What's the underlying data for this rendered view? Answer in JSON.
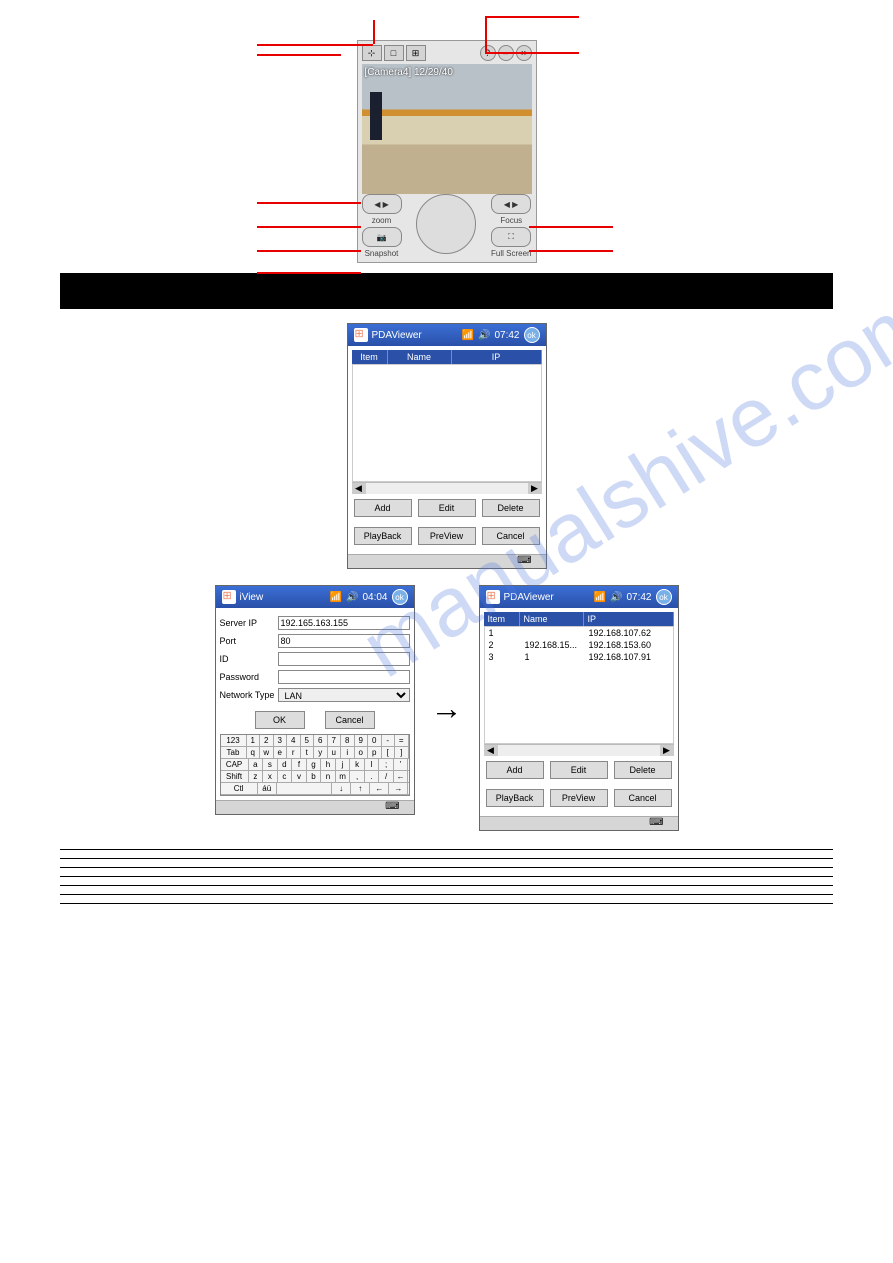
{
  "camera": {
    "overlay_text": "[Camera4] 12/29/40",
    "controls": {
      "zoom": "zoom",
      "snapshot": "Snapshot",
      "focus": "Focus",
      "fullscreen": "Full Screen"
    }
  },
  "pda_empty": {
    "title": "PDAViewer",
    "clock": "07:42",
    "ok": "ok",
    "cols": {
      "item": "Item",
      "name": "Name",
      "ip": "IP"
    },
    "btns": {
      "add": "Add",
      "edit": "Edit",
      "delete": "Delete",
      "playback": "PlayBack",
      "preview": "PreView",
      "cancel": "Cancel"
    }
  },
  "pda_form": {
    "title": "iView",
    "clock": "04:04",
    "ok": "ok",
    "labels": {
      "server_ip": "Server IP",
      "port": "Port",
      "id": "ID",
      "password": "Password",
      "net_type": "Network Type"
    },
    "values": {
      "server_ip": "192.165.163.155",
      "port": "80",
      "id": "",
      "password": "",
      "net_type": "LAN"
    },
    "btns": {
      "ok": "OK",
      "cancel": "Cancel"
    },
    "kb": {
      "r1": [
        "123",
        "1",
        "2",
        "3",
        "4",
        "5",
        "6",
        "7",
        "8",
        "9",
        "0",
        "-",
        "="
      ],
      "r2": [
        "Tab",
        "q",
        "w",
        "e",
        "r",
        "t",
        "y",
        "u",
        "i",
        "o",
        "p",
        "[",
        "]"
      ],
      "r3": [
        "CAP",
        "a",
        "s",
        "d",
        "f",
        "g",
        "h",
        "j",
        "k",
        "l",
        ";",
        "'"
      ],
      "r4": [
        "Shift",
        "z",
        "x",
        "c",
        "v",
        "b",
        "n",
        "m",
        ",",
        ".",
        "/",
        "←"
      ],
      "r5": [
        "Ctl",
        "áü",
        "",
        "",
        "",
        "",
        "",
        "",
        "",
        "↓",
        "↑",
        "←",
        "→"
      ]
    }
  },
  "pda_list": {
    "title": "PDAViewer",
    "clock": "07:42",
    "ok": "ok",
    "cols": {
      "item": "Item",
      "name": "Name",
      "ip": "IP"
    },
    "rows": [
      {
        "item": "1",
        "name": "",
        "ip": "192.168.107.62"
      },
      {
        "item": "2",
        "name": "192.168.15...",
        "ip": "192.168.153.60"
      },
      {
        "item": "3",
        "name": "1",
        "ip": "192.168.107.91"
      }
    ],
    "btns": {
      "add": "Add",
      "edit": "Edit",
      "delete": "Delete",
      "playback": "PlayBack",
      "preview": "PreView",
      "cancel": "Cancel"
    }
  },
  "watermark": "manualshive.com"
}
